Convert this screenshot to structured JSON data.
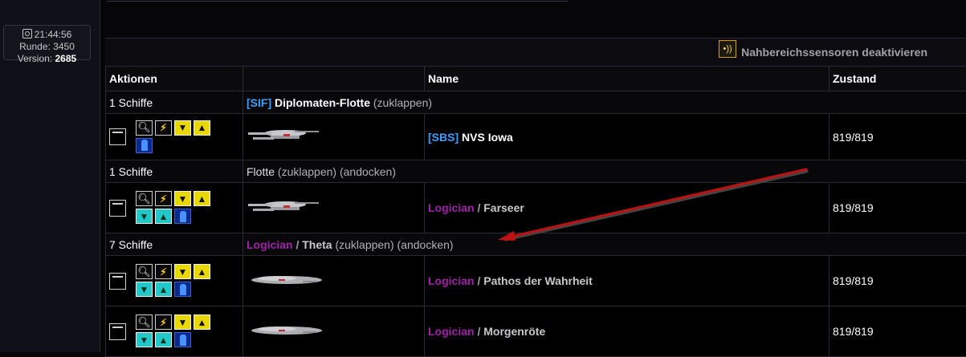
{
  "status": {
    "time": "21:44:56",
    "round_label": "Runde:",
    "round_value": "3450",
    "version_label": "Version:",
    "version_value": "2685"
  },
  "sensor": {
    "label": "Nahbereichssensoren deaktivieren",
    "icon": "sensor-icon"
  },
  "table": {
    "headers": [
      "Aktionen",
      "",
      "Name",
      "Zustand"
    ]
  },
  "groups": [
    {
      "count": "1 Schiffe",
      "tag": "[SIF]",
      "owner": "",
      "name": "Diplomaten-Flotte",
      "collapse": "(zuklappen)",
      "dock": "",
      "ships": [
        {
          "tag": "[SBS]",
          "owner": "",
          "name": "NVS Iowa",
          "state": "819/819",
          "ship_type": "starship"
        }
      ]
    },
    {
      "count": "1 Schiffe",
      "plain_name": "Flotte",
      "collapse": "(zuklappen)",
      "dock": "(andocken)",
      "ships": [
        {
          "owner": "Logician",
          "name": "Farseer",
          "state": "819/819",
          "ship_type": "starship"
        }
      ]
    },
    {
      "count": "7 Schiffe",
      "owner": "Logician",
      "name": "Theta",
      "collapse": "(zuklappen)",
      "dock": "(andocken)",
      "ships": [
        {
          "owner": "Logician",
          "name": "Pathos der Wahrheit",
          "state": "819/819",
          "ship_type": "freighter"
        },
        {
          "owner": "Logician",
          "name": "Morgenröte",
          "state": "819/819",
          "ship_type": "freighter"
        }
      ]
    }
  ],
  "separator": "/",
  "colors": {
    "tag": "#3aa0ff",
    "owner": "#a020a8",
    "arrow": "#c01010"
  }
}
